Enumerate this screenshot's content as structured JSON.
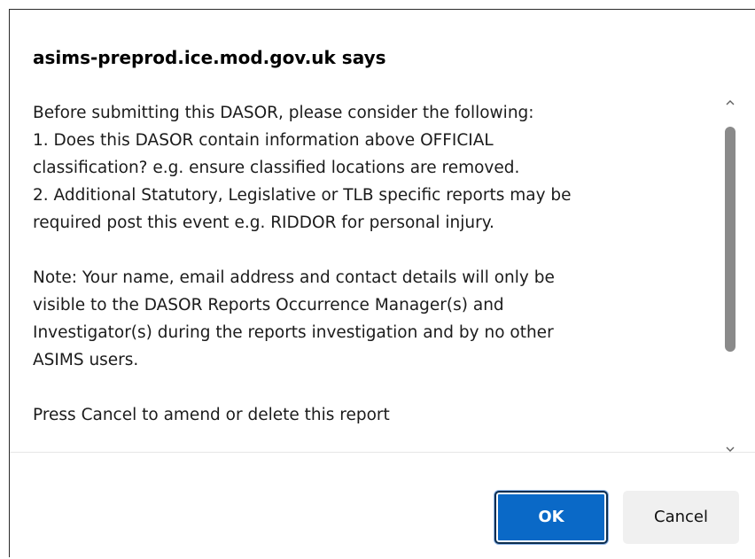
{
  "dialog": {
    "title": "asims-preprod.ice.mod.gov.uk says",
    "message": {
      "line1": "Before submitting this DASOR, please consider the following:",
      "line2": "1. Does this DASOR contain information above OFFICIAL",
      "line3": "classification? e.g. ensure classified locations are removed.",
      "line4": "2. Additional Statutory, Legislative or TLB specific reports may be",
      "line5": "required post this event e.g. RIDDOR for personal injury.",
      "line6": "Note: Your name, email address and contact details will only be",
      "line7": "visible to the DASOR Reports Occurrence Manager(s) and",
      "line8": "Investigator(s) during the reports investigation and by no other",
      "line9": "ASIMS users.",
      "line10": "Press Cancel to amend or delete this report"
    },
    "scrollbar": {
      "up_icon": "chevron-up-icon",
      "down_icon": "chevron-down-icon"
    },
    "buttons": {
      "ok_label": "OK",
      "cancel_label": "Cancel"
    }
  },
  "colors": {
    "ok_button": "#0a69c7",
    "ok_border": "#0b2d4f",
    "cancel_button": "#f0f0f0",
    "scroll_thumb": "#8a8a8a"
  }
}
